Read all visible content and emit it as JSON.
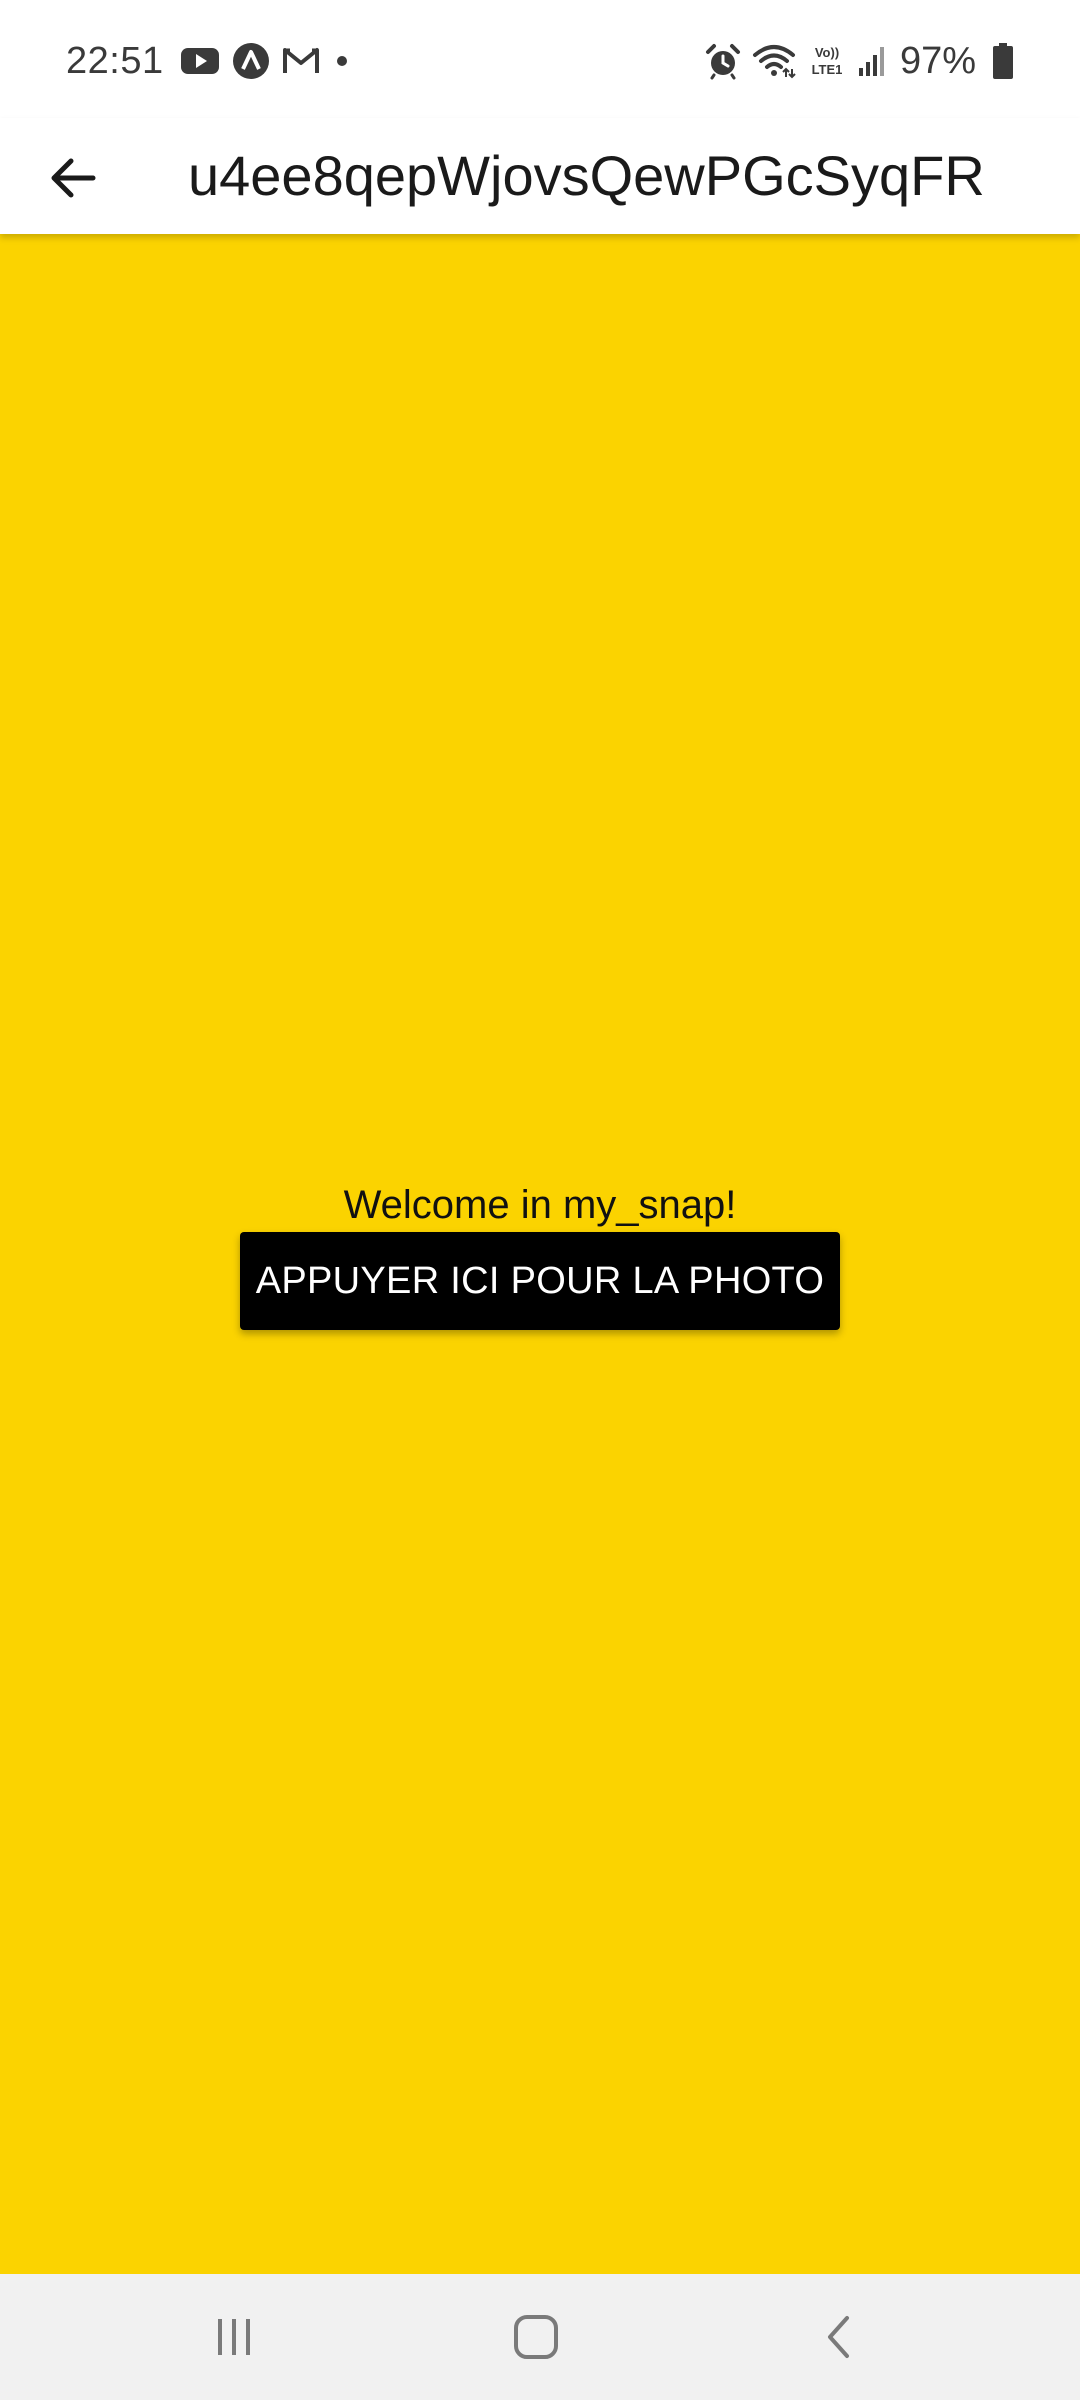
{
  "status_bar": {
    "time": "22:51",
    "battery_percent": "97%",
    "notification_icons": [
      "youtube-icon",
      "arc-app-icon",
      "gmail-icon",
      "more-notifications-dot-icon"
    ],
    "system_icons": [
      "alarm-icon",
      "wifi-icon",
      "volte-lte-icon",
      "signal-icon",
      "battery-icon"
    ],
    "volte_label_top": "Vo))",
    "volte_label_bottom": "LTE1"
  },
  "app_bar": {
    "title": "u4ee8qepWjovsQewPGcSyqFR",
    "back_icon": "arrow-left-icon"
  },
  "main": {
    "welcome_text": "Welcome in my_snap!",
    "photo_button_label": "APPUYER ICI POUR LA PHOTO"
  },
  "nav_bar": {
    "items": [
      "recent-apps-icon",
      "home-icon",
      "back-chevron-icon"
    ]
  },
  "colors": {
    "background_yellow": "#FBD300",
    "button_black": "#000000",
    "nav_bar_gray": "#f1f1f1"
  }
}
